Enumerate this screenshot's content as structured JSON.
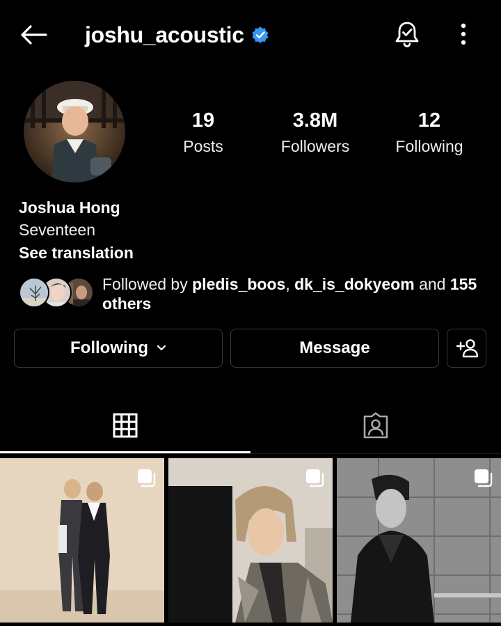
{
  "header": {
    "username": "joshu_acoustic",
    "verified": true,
    "icons": [
      "back-arrow-icon",
      "verified-badge-icon",
      "notification-bell-icon",
      "more-options-icon"
    ]
  },
  "profile": {
    "stats": {
      "posts_count": "19",
      "posts_label": "Posts",
      "followers_count": "3.8M",
      "followers_label": "Followers",
      "following_count": "12",
      "following_label": "Following"
    },
    "bio": {
      "name": "Joshua Hong",
      "description": "Seventeen",
      "see_translation": "See translation"
    },
    "followed_by": {
      "prefix": "Followed by ",
      "user1": "pledis_boos",
      "separator": ", ",
      "user2": "dk_is_dokyeom",
      "and_text": " and ",
      "others": "155 others"
    }
  },
  "actions": {
    "following_label": "Following",
    "message_label": "Message"
  },
  "tabs": [
    {
      "name": "posts-grid",
      "icon": "grid-icon",
      "active": true
    },
    {
      "name": "tagged",
      "icon": "tagged-person-icon",
      "active": false
    }
  ],
  "posts": [
    {
      "type": "multiple",
      "scene": "two men in suits against beige studio background"
    },
    {
      "type": "multiple",
      "scene": "blond man in leather jacket profile view"
    },
    {
      "type": "multiple",
      "scene": "black and white man leaning on tiled wall"
    }
  ],
  "colors": {
    "background": "#000000",
    "text": "#f5f5f5",
    "verified_blue": "#3897f0",
    "button_border": "#3a3a3a"
  }
}
